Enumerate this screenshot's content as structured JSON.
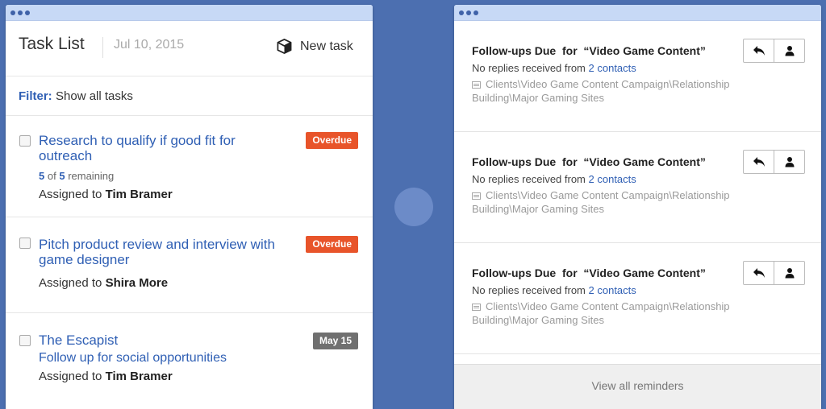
{
  "task_list": {
    "title": "Task List",
    "date": "Jul 10, 2015",
    "new_task_label": "New task",
    "filter": {
      "label": "Filter:",
      "value": "Show all tasks"
    },
    "tasks": [
      {
        "title": "Research to qualify if good fit for outreach",
        "remaining_done": "5",
        "remaining_of": "of",
        "remaining_total": "5",
        "remaining_word": "remaining",
        "assigned_prefix": "Assigned to",
        "assignee": "Tim Bramer",
        "badge": "Overdue"
      },
      {
        "title": "Pitch product review and interview with game designer",
        "assigned_prefix": "Assigned to",
        "assignee": "Shira More",
        "badge": "Overdue"
      },
      {
        "title": "The Escapist",
        "subtitle": "Follow up for social opportunities",
        "assigned_prefix": "Assigned to",
        "assignee": "Tim Bramer",
        "badge": "May 15"
      }
    ]
  },
  "reminders": {
    "items": [
      {
        "title": "Follow-ups Due  for  “Video Game Content”",
        "sub_prefix": "No replies received from",
        "link": "2 contacts",
        "path": "Clients\\Video Game Content Campaign\\Relationship Building\\Major Gaming Sites"
      },
      {
        "title": "Follow-ups Due  for  “Video Game Content”",
        "sub_prefix": "No replies received from",
        "link": "2 contacts",
        "path": "Clients\\Video Game Content Campaign\\Relationship Building\\Major Gaming Sites"
      },
      {
        "title": "Follow-ups Due  for  “Video Game Content”",
        "sub_prefix": "No replies received from",
        "link": "2 contacts",
        "path": "Clients\\Video Game Content Campaign\\Relationship Building\\Major Gaming Sites"
      }
    ],
    "footer_label": "View all reminders"
  },
  "icons": {
    "new_task": "cube-icon",
    "reply": "reply-icon",
    "contact": "person-icon",
    "folder": "folder-icon"
  },
  "colors": {
    "background": "#4c6fb0",
    "link": "#2f5fb4",
    "overdue": "#e8542a",
    "date_badge": "#707070",
    "titlebar": "#c7d9f6"
  }
}
